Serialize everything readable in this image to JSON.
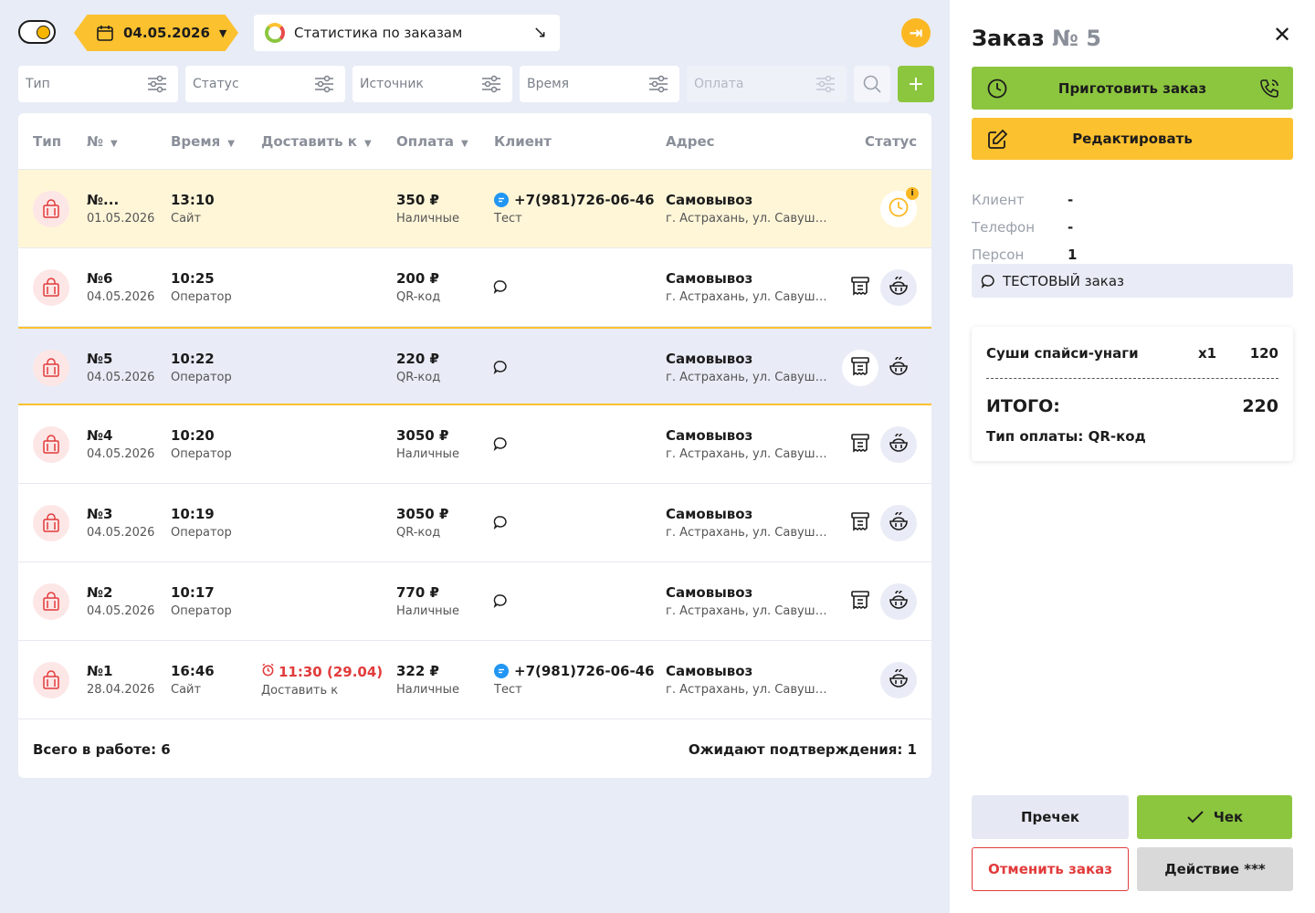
{
  "header": {
    "date": "04.05.2026",
    "stats_label": "Статистика по заказам"
  },
  "filters": {
    "type": "Тип",
    "status": "Статус",
    "source": "Источник",
    "time": "Время",
    "payment": "Оплата"
  },
  "table": {
    "headers": {
      "type": "Тип",
      "num": "№",
      "time": "Время",
      "deliver": "Доставить к",
      "payment": "Оплата",
      "client": "Клиент",
      "address": "Адрес",
      "status": "Статус"
    },
    "rows": [
      {
        "num": "№...",
        "date": "01.05.2026",
        "time": "13:10",
        "source": "Сайт",
        "deliver_time": "",
        "deliver_label": "",
        "amount": "350 ₽",
        "pay_method": "Наличные",
        "client_phone": "+7(981)726-06-46",
        "client_name": "Тест",
        "addr_title": "Самовывоз",
        "addr_sub": "г. Астрахань, ул. Савушкина"
      },
      {
        "num": "№6",
        "date": "04.05.2026",
        "time": "10:25",
        "source": "Оператор",
        "deliver_time": "",
        "deliver_label": "",
        "amount": "200 ₽",
        "pay_method": "QR-код",
        "client_phone": "",
        "client_name": "",
        "addr_title": "Самовывоз",
        "addr_sub": "г. Астрахань, ул. Савушкина"
      },
      {
        "num": "№5",
        "date": "04.05.2026",
        "time": "10:22",
        "source": "Оператор",
        "deliver_time": "",
        "deliver_label": "",
        "amount": "220 ₽",
        "pay_method": "QR-код",
        "client_phone": "",
        "client_name": "",
        "addr_title": "Самовывоз",
        "addr_sub": "г. Астрахань, ул. Савушкина"
      },
      {
        "num": "№4",
        "date": "04.05.2026",
        "time": "10:20",
        "source": "Оператор",
        "deliver_time": "",
        "deliver_label": "",
        "amount": "3050 ₽",
        "pay_method": "Наличные",
        "client_phone": "",
        "client_name": "",
        "addr_title": "Самовывоз",
        "addr_sub": "г. Астрахань, ул. Савушкина"
      },
      {
        "num": "№3",
        "date": "04.05.2026",
        "time": "10:19",
        "source": "Оператор",
        "deliver_time": "",
        "deliver_label": "",
        "amount": "3050 ₽",
        "pay_method": "QR-код",
        "client_phone": "",
        "client_name": "",
        "addr_title": "Самовывоз",
        "addr_sub": "г. Астрахань, ул. Савушкина"
      },
      {
        "num": "№2",
        "date": "04.05.2026",
        "time": "10:17",
        "source": "Оператор",
        "deliver_time": "",
        "deliver_label": "",
        "amount": "770 ₽",
        "pay_method": "Наличные",
        "client_phone": "",
        "client_name": "",
        "addr_title": "Самовывоз",
        "addr_sub": "г. Астрахань, ул. Савушкина"
      },
      {
        "num": "№1",
        "date": "28.04.2026",
        "time": "16:46",
        "source": "Сайт",
        "deliver_time": "11:30 (29.04)",
        "deliver_label": "Доставить к",
        "amount": "322 ₽",
        "pay_method": "Наличные",
        "client_phone": "+7(981)726-06-46",
        "client_name": "Тест",
        "addr_title": "Самовывоз",
        "addr_sub": "г. Астрахань, ул. Савушкина"
      }
    ],
    "footer_total": "Всего в работе: 6",
    "footer_pending": "Ожидают подтверждения: 1"
  },
  "order": {
    "title": "Заказ",
    "number": "№ 5",
    "cook_label": "Приготовить заказ",
    "edit_label": "Редактировать",
    "client_label": "Клиент",
    "client_value": "-",
    "phone_label": "Телефон",
    "phone_value": "-",
    "persons_label": "Персон",
    "persons_value": "1",
    "comment": "ТЕСТОВЫЙ заказ",
    "item_name": "Суши спайси-унаги",
    "item_qty": "x1",
    "item_price": "120",
    "total_label": "ИТОГО:",
    "total_value": "220",
    "pay_type": "Тип оплаты: QR-код",
    "precheck_label": "Пречек",
    "check_label": "Чек",
    "cancel_label": "Отменить заказ",
    "action_label": "Действие ***"
  },
  "colors": {
    "yellow": "#fcc12f",
    "green": "#8cc63f",
    "red": "#e23b3b",
    "highlight_row": "#fff6d8",
    "selected_row": "#e9ecf7"
  }
}
